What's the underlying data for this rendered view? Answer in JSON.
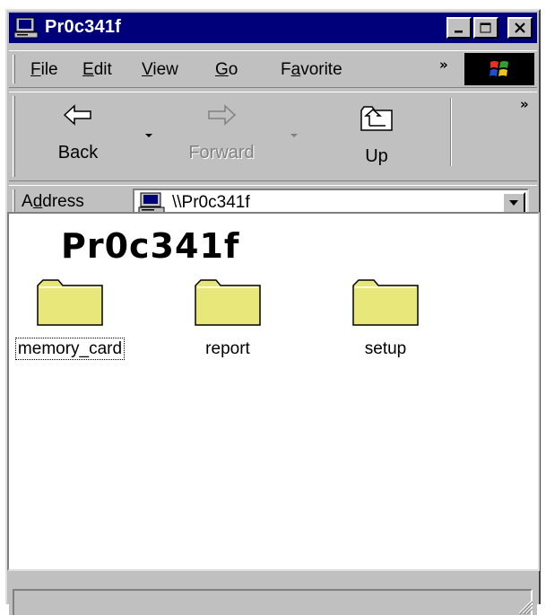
{
  "window": {
    "title": "Pr0c341f",
    "controls": {
      "minimize": "minimize",
      "maximize": "maximize",
      "close": "close"
    }
  },
  "menu": {
    "items": [
      {
        "label": "File",
        "accel": "F"
      },
      {
        "label": "Edit",
        "accel": "E"
      },
      {
        "label": "View",
        "accel": "V"
      },
      {
        "label": "Go",
        "accel": "G"
      },
      {
        "label": "Favorite",
        "accel": "a"
      }
    ],
    "more": "»"
  },
  "toolbar": {
    "back": {
      "label": "Back",
      "enabled": true
    },
    "forward": {
      "label": "Forward",
      "enabled": false
    },
    "up": {
      "label": "Up",
      "enabled": true
    },
    "more": "»"
  },
  "address": {
    "label": "Address",
    "accel": "d",
    "value": "\\\\Pr0c341f"
  },
  "content": {
    "heading": "Pr0c341f",
    "folders": [
      {
        "name": "memory_card",
        "focused": true
      },
      {
        "name": "report",
        "focused": false
      },
      {
        "name": "setup",
        "focused": false
      }
    ]
  },
  "status": {
    "text": ""
  },
  "colors": {
    "titlebar": "#00007b",
    "face": "#c0c0c0",
    "folder": "#e8e87a"
  }
}
